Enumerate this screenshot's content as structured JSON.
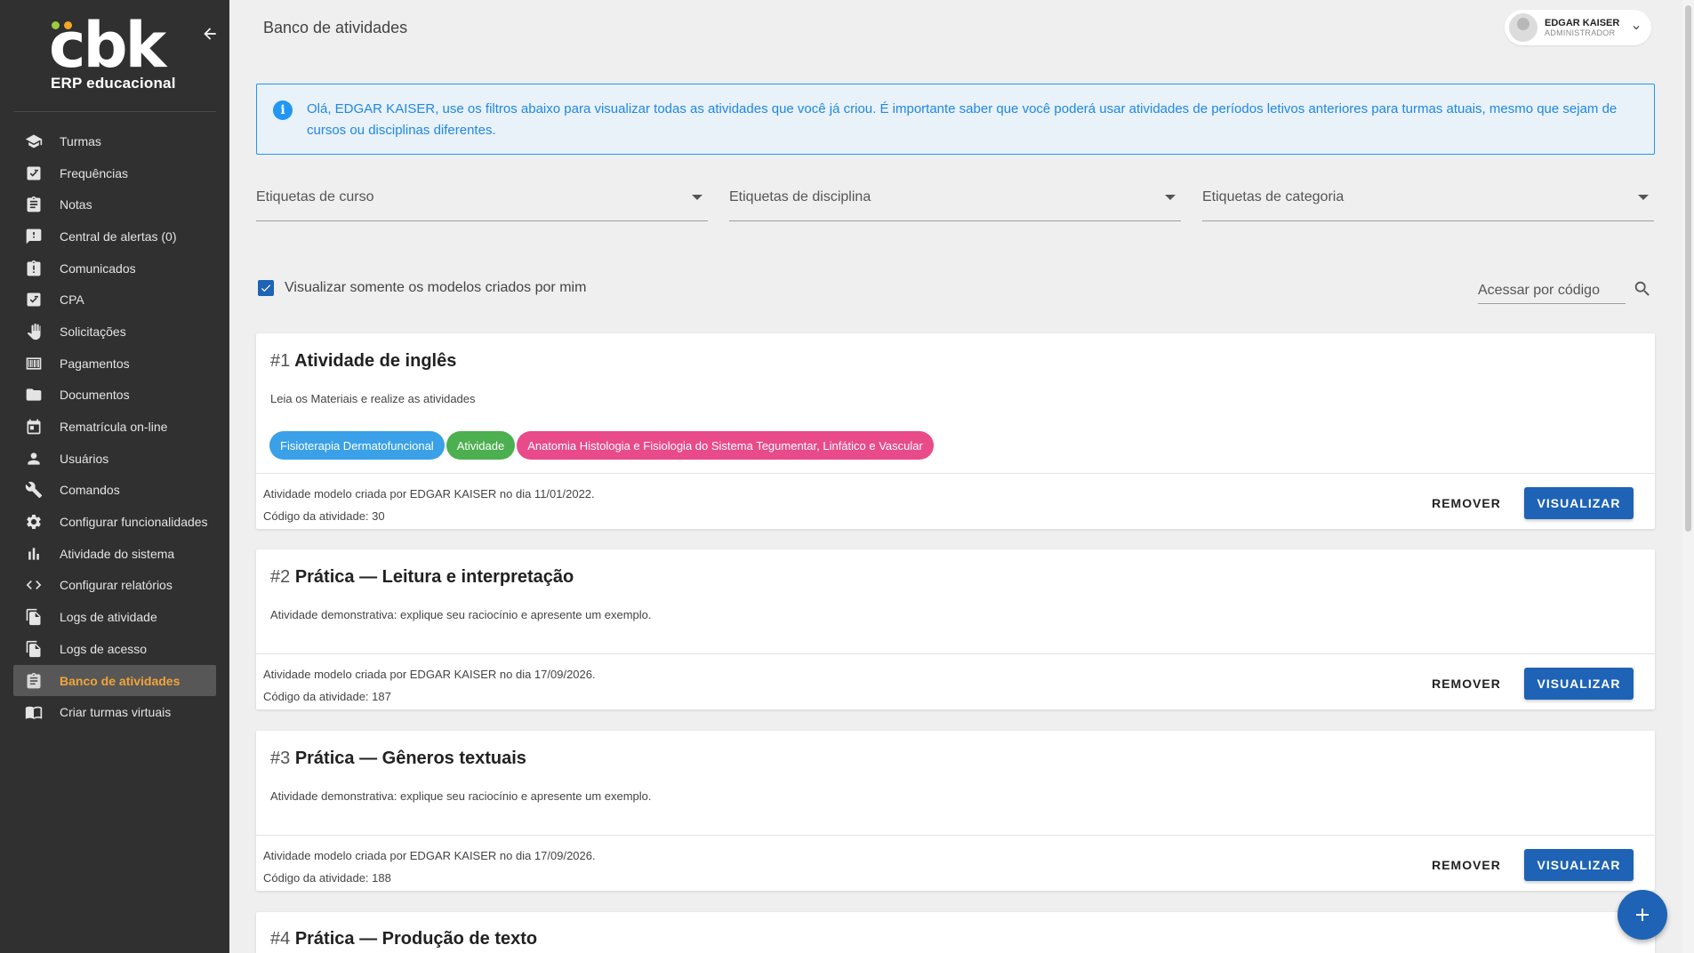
{
  "sidebar": {
    "logo_word": "cbk",
    "logo_sub": "ERP educacional",
    "items": [
      {
        "label": "Turmas",
        "icon": "school-icon"
      },
      {
        "label": "Frequências",
        "icon": "checklist-icon"
      },
      {
        "label": "Notas",
        "icon": "clipboard-icon"
      },
      {
        "label": "Central de alertas (0)",
        "icon": "alert-message-icon"
      },
      {
        "label": "Comunicados",
        "icon": "clipboard-alert-icon"
      },
      {
        "label": "CPA",
        "icon": "checklist-icon"
      },
      {
        "label": "Solicitações",
        "icon": "hand-icon"
      },
      {
        "label": "Pagamentos",
        "icon": "barcode-icon"
      },
      {
        "label": "Documentos",
        "icon": "folder-icon"
      },
      {
        "label": "Rematrícula on-line",
        "icon": "calendar-icon"
      },
      {
        "label": "Usuários",
        "icon": "person-icon"
      },
      {
        "label": "Comandos",
        "icon": "wrench-icon"
      },
      {
        "label": "Configurar funcionalidades",
        "icon": "gear-icon"
      },
      {
        "label": "Atividade do sistema",
        "icon": "bar-chart-icon"
      },
      {
        "label": "Configurar relatórios",
        "icon": "code-icon"
      },
      {
        "label": "Logs de atividade",
        "icon": "file-copy-icon"
      },
      {
        "label": "Logs de acesso",
        "icon": "file-copy-icon"
      },
      {
        "label": "Banco de atividades",
        "icon": "clipboard-list-icon",
        "active": true
      },
      {
        "label": "Criar turmas virtuais",
        "icon": "book-icon"
      }
    ]
  },
  "header": {
    "title": "Banco de atividades",
    "user_name": "EDGAR KAISER",
    "user_role": "ADMINISTRADOR"
  },
  "alert": {
    "text": "Olá, EDGAR KAISER, use os filtros abaixo para visualizar todas as atividades que você já criou. É importante saber que você poderá usar atividades de períodos letivos anteriores para turmas atuais, mesmo que sejam de cursos ou disciplinas diferentes."
  },
  "filters": {
    "course": "Etiquetas de curso",
    "discipline": "Etiquetas de disciplina",
    "category": "Etiquetas de categoria",
    "only_mine": "Visualizar somente os modelos criados por mim",
    "code_placeholder": "Acessar por código"
  },
  "actions": {
    "remove": "REMOVER",
    "view": "VISUALIZAR"
  },
  "activities": [
    {
      "num": "#1",
      "title": "Atividade de inglês",
      "desc": "Leia os Materiais e realize as atividades",
      "tags": [
        {
          "label": "Fisioterapia Dermatofuncional",
          "color": "#3aa0e8"
        },
        {
          "label": "Atividade",
          "color": "#4caf50"
        },
        {
          "label": "Anatomia Histologia e Fisiologia do Sistema Tegumentar, Linfático e Vascular",
          "color": "#e84a8a"
        }
      ],
      "created": "Atividade modelo criada por EDGAR KAISER no dia 11/01/2022.",
      "code": "Código da atividade: 30"
    },
    {
      "num": "#2",
      "title": "Prática — Leitura e interpretação",
      "desc": "Atividade demonstrativa: explique seu raciocínio e apresente um exemplo.",
      "created": "Atividade modelo criada por EDGAR KAISER no dia 17/09/2026.",
      "code": "Código da atividade: 187"
    },
    {
      "num": "#3",
      "title": "Prática — Gêneros textuais",
      "desc": "Atividade demonstrativa: explique seu raciocínio e apresente um exemplo.",
      "created": "Atividade modelo criada por EDGAR KAISER no dia 17/09/2026.",
      "code": "Código da atividade: 188"
    },
    {
      "num": "#4",
      "title": "Prática — Produção de texto"
    }
  ],
  "colors": {
    "primary": "#1e63b5",
    "sidebar_bg": "#303030",
    "active_text": "#f0a43a",
    "info": "#2196f3"
  }
}
